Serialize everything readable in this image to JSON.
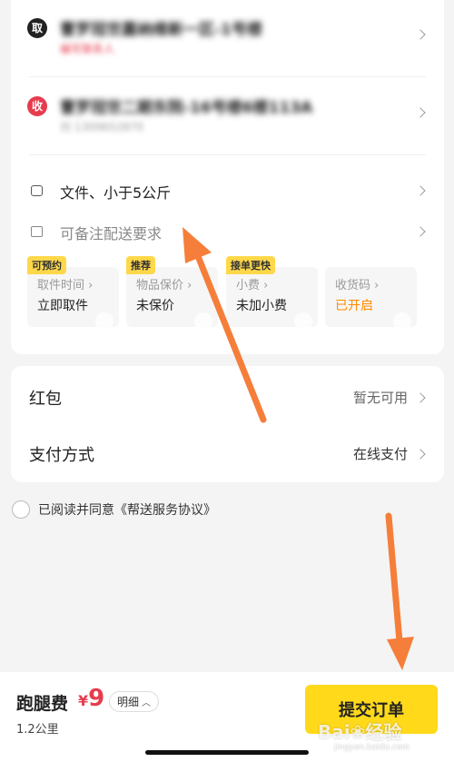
{
  "pickup": {
    "badge": "取",
    "address": "曹罗冠世嘉纳维新一区-1号楼",
    "subtext": "编写联系人"
  },
  "dropoff": {
    "badge": "收",
    "address": "曹罗冠世二期东院-16号楼6楼113A",
    "subtext": "刘 1309652870"
  },
  "package": {
    "icon": "package-icon",
    "text": "文件、小于5公斤"
  },
  "note": {
    "icon": "note-edit-icon",
    "placeholder": "可备注配送要求"
  },
  "options": [
    {
      "tag": "可预约",
      "label": "取件时间 ›",
      "value": "立即取件"
    },
    {
      "tag": "推荐",
      "label": "物品保价 ›",
      "value": "未保价"
    },
    {
      "tag": "接单更快",
      "label": "小费 ›",
      "value": "未加小费"
    },
    {
      "tag": "",
      "label": "收货码 ›",
      "value": "已开启"
    }
  ],
  "payment": {
    "red_packet_label": "红包",
    "red_packet_value": "暂无可用",
    "method_label": "支付方式",
    "method_value": "在线支付"
  },
  "agreement": {
    "text": "已阅读并同意《帮送服务协议》"
  },
  "footer": {
    "fee_label": "跑腿费",
    "currency": "¥",
    "amount": "9",
    "detail_label": "明细",
    "distance": "1.2公里",
    "submit_label": "提交订单"
  },
  "watermark": {
    "text": "Bai❀经验",
    "sub": "jingyan.baidu.com"
  },
  "colors": {
    "accent_yellow": "#ffd91a",
    "price_red": "#e63c4e",
    "annotation_orange": "#f57e3a"
  }
}
